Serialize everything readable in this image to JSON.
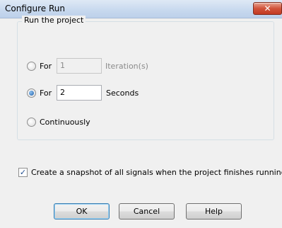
{
  "window": {
    "title": "Configure Run",
    "close_glyph": "✕"
  },
  "group": {
    "legend": "Run the project",
    "options": [
      {
        "label": "For",
        "value": "1",
        "unit": "Iteration(s)",
        "checked": false,
        "enabled": false
      },
      {
        "label": "For",
        "value": "2",
        "unit": "Seconds",
        "checked": true,
        "enabled": true
      },
      {
        "label": "Continuously",
        "checked": false,
        "enabled": true
      }
    ]
  },
  "snapshot": {
    "label": "Create a snapshot of all signals when the project finishes running",
    "checked": true,
    "check_glyph": "✓"
  },
  "buttons": {
    "ok": "OK",
    "cancel": "Cancel",
    "help": "Help"
  }
}
